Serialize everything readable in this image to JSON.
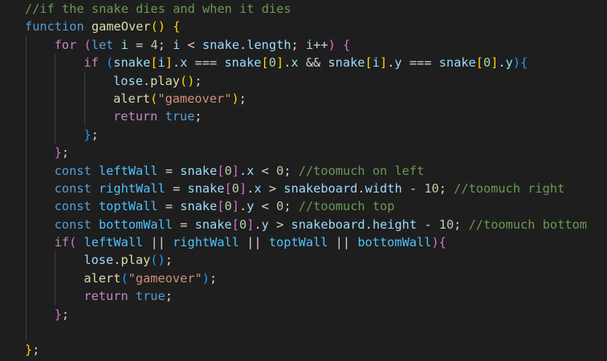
{
  "colors": {
    "background": "#1e1e1e",
    "indent_guide": "#404040",
    "comment": "#6a9955",
    "keyword": "#569cd6",
    "control": "#c586c0",
    "function": "#dcdcaa",
    "variable": "#9cdcfe",
    "constant": "#4fc1ff",
    "number": "#b5cea8",
    "string": "#ce9178",
    "text": "#d4d4d4",
    "bracket1": "#ffd700",
    "bracket2": "#da70d6",
    "bracket3": "#179fff"
  },
  "lines": [
    {
      "indent": 0,
      "tokens": [
        {
          "t": "//if the snake dies and when it dies",
          "c": "comment"
        }
      ]
    },
    {
      "indent": 0,
      "tokens": [
        {
          "t": "function",
          "c": "keyword"
        },
        {
          "t": " ",
          "c": "text"
        },
        {
          "t": "gameOver",
          "c": "function"
        },
        {
          "t": "()",
          "c": "bracket1"
        },
        {
          "t": " ",
          "c": "text"
        },
        {
          "t": "{",
          "c": "bracket1"
        }
      ]
    },
    {
      "indent": 1,
      "tokens": [
        {
          "t": "for",
          "c": "control"
        },
        {
          "t": " ",
          "c": "text"
        },
        {
          "t": "(",
          "c": "bracket2"
        },
        {
          "t": "let",
          "c": "keyword"
        },
        {
          "t": " ",
          "c": "text"
        },
        {
          "t": "i",
          "c": "variable"
        },
        {
          "t": " = ",
          "c": "text"
        },
        {
          "t": "4",
          "c": "number"
        },
        {
          "t": "; ",
          "c": "text"
        },
        {
          "t": "i",
          "c": "variable"
        },
        {
          "t": " < ",
          "c": "text"
        },
        {
          "t": "snake",
          "c": "variable"
        },
        {
          "t": ".",
          "c": "text"
        },
        {
          "t": "length",
          "c": "variable"
        },
        {
          "t": "; ",
          "c": "text"
        },
        {
          "t": "i",
          "c": "variable"
        },
        {
          "t": "++",
          "c": "text"
        },
        {
          "t": ")",
          "c": "bracket2"
        },
        {
          "t": " ",
          "c": "text"
        },
        {
          "t": "{",
          "c": "bracket2"
        }
      ]
    },
    {
      "indent": 2,
      "tokens": [
        {
          "t": "if",
          "c": "control"
        },
        {
          "t": " ",
          "c": "text"
        },
        {
          "t": "(",
          "c": "bracket3"
        },
        {
          "t": "snake",
          "c": "variable"
        },
        {
          "t": "[",
          "c": "bracket1"
        },
        {
          "t": "i",
          "c": "variable"
        },
        {
          "t": "]",
          "c": "bracket1"
        },
        {
          "t": ".",
          "c": "text"
        },
        {
          "t": "x",
          "c": "variable"
        },
        {
          "t": " === ",
          "c": "text"
        },
        {
          "t": "snake",
          "c": "variable"
        },
        {
          "t": "[",
          "c": "bracket1"
        },
        {
          "t": "0",
          "c": "number"
        },
        {
          "t": "]",
          "c": "bracket1"
        },
        {
          "t": ".",
          "c": "text"
        },
        {
          "t": "x",
          "c": "variable"
        },
        {
          "t": " && ",
          "c": "text"
        },
        {
          "t": "snake",
          "c": "variable"
        },
        {
          "t": "[",
          "c": "bracket1"
        },
        {
          "t": "i",
          "c": "variable"
        },
        {
          "t": "]",
          "c": "bracket1"
        },
        {
          "t": ".",
          "c": "text"
        },
        {
          "t": "y",
          "c": "variable"
        },
        {
          "t": " === ",
          "c": "text"
        },
        {
          "t": "snake",
          "c": "variable"
        },
        {
          "t": "[",
          "c": "bracket1"
        },
        {
          "t": "0",
          "c": "number"
        },
        {
          "t": "]",
          "c": "bracket1"
        },
        {
          "t": ".",
          "c": "text"
        },
        {
          "t": "y",
          "c": "variable"
        },
        {
          "t": ")",
          "c": "bracket3"
        },
        {
          "t": "{",
          "c": "bracket3"
        }
      ]
    },
    {
      "indent": 3,
      "tokens": [
        {
          "t": "lose",
          "c": "variable"
        },
        {
          "t": ".",
          "c": "text"
        },
        {
          "t": "play",
          "c": "function"
        },
        {
          "t": "()",
          "c": "bracket1"
        },
        {
          "t": ";",
          "c": "text"
        }
      ]
    },
    {
      "indent": 3,
      "tokens": [
        {
          "t": "alert",
          "c": "function"
        },
        {
          "t": "(",
          "c": "bracket1"
        },
        {
          "t": "\"gameover\"",
          "c": "string"
        },
        {
          "t": ")",
          "c": "bracket1"
        },
        {
          "t": ";",
          "c": "text"
        }
      ]
    },
    {
      "indent": 3,
      "tokens": [
        {
          "t": "return",
          "c": "control"
        },
        {
          "t": " ",
          "c": "text"
        },
        {
          "t": "true",
          "c": "keyword"
        },
        {
          "t": ";",
          "c": "text"
        }
      ]
    },
    {
      "indent": 2,
      "tokens": [
        {
          "t": "}",
          "c": "bracket3"
        },
        {
          "t": ";",
          "c": "text"
        }
      ]
    },
    {
      "indent": 1,
      "tokens": [
        {
          "t": "}",
          "c": "bracket2"
        },
        {
          "t": ";",
          "c": "text"
        }
      ]
    },
    {
      "indent": 1,
      "tokens": [
        {
          "t": "const",
          "c": "keyword"
        },
        {
          "t": " ",
          "c": "text"
        },
        {
          "t": "leftWall",
          "c": "constant"
        },
        {
          "t": " = ",
          "c": "text"
        },
        {
          "t": "snake",
          "c": "variable"
        },
        {
          "t": "[",
          "c": "bracket2"
        },
        {
          "t": "0",
          "c": "number"
        },
        {
          "t": "]",
          "c": "bracket2"
        },
        {
          "t": ".",
          "c": "text"
        },
        {
          "t": "x",
          "c": "variable"
        },
        {
          "t": " < ",
          "c": "text"
        },
        {
          "t": "0",
          "c": "number"
        },
        {
          "t": "; ",
          "c": "text"
        },
        {
          "t": "//toomuch on left",
          "c": "comment"
        }
      ]
    },
    {
      "indent": 1,
      "tokens": [
        {
          "t": "const",
          "c": "keyword"
        },
        {
          "t": " ",
          "c": "text"
        },
        {
          "t": "rightWall",
          "c": "constant"
        },
        {
          "t": " = ",
          "c": "text"
        },
        {
          "t": "snake",
          "c": "variable"
        },
        {
          "t": "[",
          "c": "bracket2"
        },
        {
          "t": "0",
          "c": "number"
        },
        {
          "t": "]",
          "c": "bracket2"
        },
        {
          "t": ".",
          "c": "text"
        },
        {
          "t": "x",
          "c": "variable"
        },
        {
          "t": " > ",
          "c": "text"
        },
        {
          "t": "snakeboard",
          "c": "variable"
        },
        {
          "t": ".",
          "c": "text"
        },
        {
          "t": "width",
          "c": "variable"
        },
        {
          "t": " - ",
          "c": "text"
        },
        {
          "t": "10",
          "c": "number"
        },
        {
          "t": "; ",
          "c": "text"
        },
        {
          "t": "//toomuch right",
          "c": "comment"
        }
      ]
    },
    {
      "indent": 1,
      "tokens": [
        {
          "t": "const",
          "c": "keyword"
        },
        {
          "t": " ",
          "c": "text"
        },
        {
          "t": "toptWall",
          "c": "constant"
        },
        {
          "t": " = ",
          "c": "text"
        },
        {
          "t": "snake",
          "c": "variable"
        },
        {
          "t": "[",
          "c": "bracket2"
        },
        {
          "t": "0",
          "c": "number"
        },
        {
          "t": "]",
          "c": "bracket2"
        },
        {
          "t": ".",
          "c": "text"
        },
        {
          "t": "y",
          "c": "variable"
        },
        {
          "t": " < ",
          "c": "text"
        },
        {
          "t": "0",
          "c": "number"
        },
        {
          "t": "; ",
          "c": "text"
        },
        {
          "t": "//toomuch top",
          "c": "comment"
        }
      ]
    },
    {
      "indent": 1,
      "tokens": [
        {
          "t": "const",
          "c": "keyword"
        },
        {
          "t": " ",
          "c": "text"
        },
        {
          "t": "bottomWall",
          "c": "constant"
        },
        {
          "t": " = ",
          "c": "text"
        },
        {
          "t": "snake",
          "c": "variable"
        },
        {
          "t": "[",
          "c": "bracket2"
        },
        {
          "t": "0",
          "c": "number"
        },
        {
          "t": "]",
          "c": "bracket2"
        },
        {
          "t": ".",
          "c": "text"
        },
        {
          "t": "y",
          "c": "variable"
        },
        {
          "t": " > ",
          "c": "text"
        },
        {
          "t": "snakeboard",
          "c": "variable"
        },
        {
          "t": ".",
          "c": "text"
        },
        {
          "t": "height",
          "c": "variable"
        },
        {
          "t": " - ",
          "c": "text"
        },
        {
          "t": "10",
          "c": "number"
        },
        {
          "t": "; ",
          "c": "text"
        },
        {
          "t": "//toomuch bottom",
          "c": "comment"
        }
      ]
    },
    {
      "indent": 1,
      "tokens": [
        {
          "t": "if",
          "c": "control"
        },
        {
          "t": "(",
          "c": "bracket2"
        },
        {
          "t": " ",
          "c": "text"
        },
        {
          "t": "leftWall",
          "c": "constant"
        },
        {
          "t": " || ",
          "c": "text"
        },
        {
          "t": "rightWall",
          "c": "constant"
        },
        {
          "t": " || ",
          "c": "text"
        },
        {
          "t": "toptWall",
          "c": "constant"
        },
        {
          "t": " || ",
          "c": "text"
        },
        {
          "t": "bottomWall",
          "c": "constant"
        },
        {
          "t": ")",
          "c": "bracket2"
        },
        {
          "t": "{",
          "c": "bracket2"
        }
      ]
    },
    {
      "indent": 2,
      "tokens": [
        {
          "t": "lose",
          "c": "variable"
        },
        {
          "t": ".",
          "c": "text"
        },
        {
          "t": "play",
          "c": "function"
        },
        {
          "t": "()",
          "c": "bracket3"
        },
        {
          "t": ";",
          "c": "text"
        }
      ]
    },
    {
      "indent": 2,
      "tokens": [
        {
          "t": "alert",
          "c": "function"
        },
        {
          "t": "(",
          "c": "bracket3"
        },
        {
          "t": "\"gameover\"",
          "c": "string"
        },
        {
          "t": ")",
          "c": "bracket3"
        },
        {
          "t": ";",
          "c": "text"
        }
      ]
    },
    {
      "indent": 2,
      "tokens": [
        {
          "t": "return",
          "c": "control"
        },
        {
          "t": " ",
          "c": "text"
        },
        {
          "t": "true",
          "c": "keyword"
        },
        {
          "t": ";",
          "c": "text"
        }
      ]
    },
    {
      "indent": 1,
      "tokens": [
        {
          "t": "}",
          "c": "bracket2"
        },
        {
          "t": ";",
          "c": "text"
        }
      ]
    },
    {
      "indent": 1,
      "tokens": []
    },
    {
      "indent": 0,
      "tokens": [
        {
          "t": "}",
          "c": "bracket1"
        },
        {
          "t": ";",
          "c": "text"
        }
      ]
    }
  ]
}
